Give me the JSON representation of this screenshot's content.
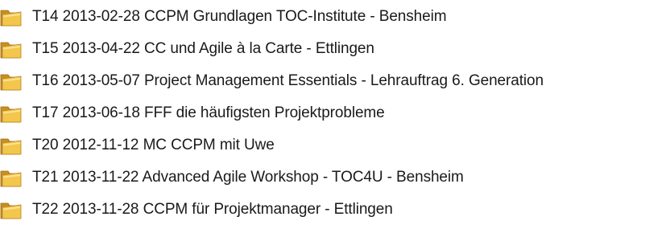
{
  "folders": [
    {
      "name": "T14 2013-02-28 CCPM Grundlagen TOC-Institute - Bensheim",
      "icon": "folder-icon"
    },
    {
      "name": "T15 2013-04-22 CC und Agile à la Carte - Ettlingen",
      "icon": "folder-icon"
    },
    {
      "name": "T16 2013-05-07 Project Management Essentials - Lehrauftrag 6. Generation",
      "icon": "folder-icon"
    },
    {
      "name": "T17 2013-06-18 FFF die häufigsten Projektprobleme",
      "icon": "folder-icon"
    },
    {
      "name": "T20 2012-11-12 MC CCPM mit Uwe",
      "icon": "folder-icon"
    },
    {
      "name": "T21 2013-11-22 Advanced Agile Workshop - TOC4U - Bensheim",
      "icon": "folder-icon"
    },
    {
      "name": "T22 2013-11-28 CCPM für Projektmanager - Ettlingen",
      "icon": "folder-icon"
    }
  ],
  "colors": {
    "folder_back": "#d49a2e",
    "folder_front": "#f3c64c",
    "folder_highlight": "#fbe29a",
    "text": "#1a1a1a",
    "background": "#ffffff"
  }
}
